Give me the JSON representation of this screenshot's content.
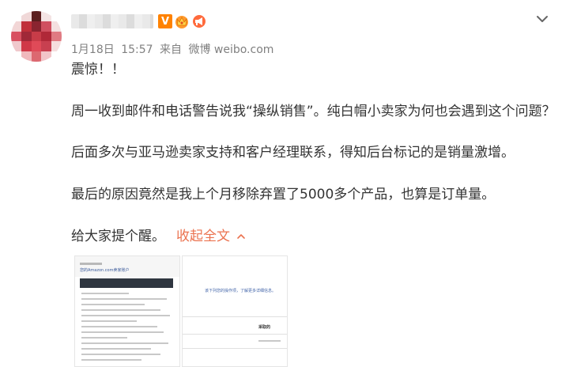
{
  "post": {
    "author_name_blurred": "",
    "badges": [
      "verified-v-icon",
      "crown-icon",
      "horn-icon"
    ],
    "verified_label": "V",
    "date": "1月18日",
    "time": "15:57",
    "source_prefix": "来自",
    "source": "微博 weibo.com",
    "paragraphs": [
      "震惊！！",
      "周一收到邮件和电话警告说我“操纵销售”。纯白帽小卖家为何也会遇到这个问题？",
      "后面多次与亚马逊卖家支持和客户经理联系，得知后台标记的是销量激增。",
      "最后的原因竟然是我上个月移除弃置了5000多个产品，也算是订单量。"
    ],
    "last_line": "给大家提个醒。",
    "collapse_label": "收起全文",
    "images": [
      {
        "alt": "email screenshot",
        "caption": "您的Amazon.com卖家账户"
      },
      {
        "alt": "seller central screenshot",
        "caption": "该下列您的操作项，了解更多详细信息。",
        "heading": "采取的"
      }
    ]
  },
  "colors": {
    "accent": "#eb7350",
    "meta_text": "#808080",
    "body_text": "#333333",
    "badge_orange": "#ff8200"
  }
}
